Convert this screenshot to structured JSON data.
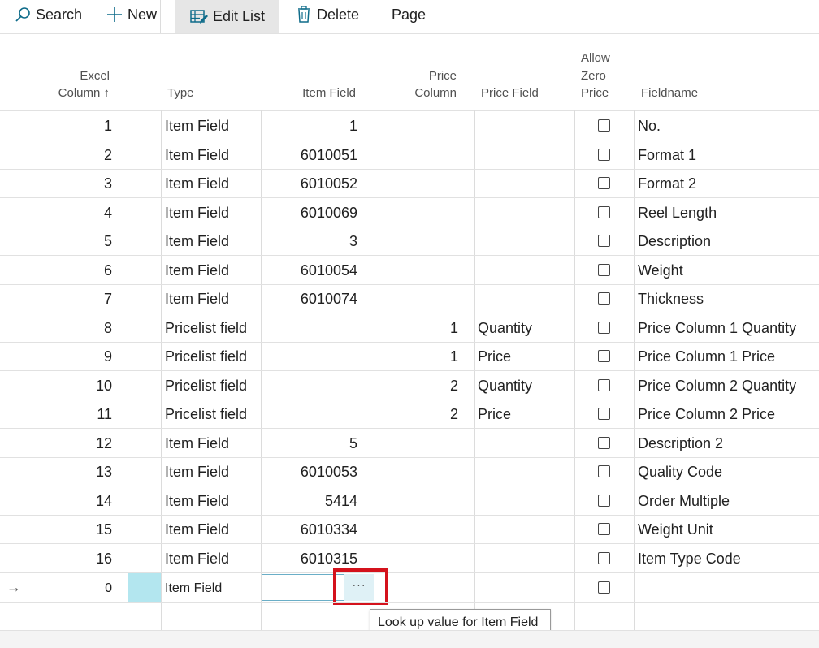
{
  "toolbar": {
    "search_label": "Search",
    "new_label": "New",
    "edit_list_label": "Edit List",
    "delete_label": "Delete",
    "page_label": "Page"
  },
  "columns": {
    "excel_column_line1": "Excel",
    "excel_column_line2": "Column ↑",
    "type": "Type",
    "item_field": "Item Field",
    "price_column_line1": "Price",
    "price_column_line2": "Column",
    "price_field": "Price Field",
    "allow_zero_line1": "Allow",
    "allow_zero_line2": "Zero",
    "allow_zero_line3": "Price",
    "fieldname": "Fieldname"
  },
  "rows": [
    {
      "excel_column": "1",
      "type": "Item Field",
      "item_field": "1",
      "price_column": "",
      "price_field": "",
      "allow_zero_price": false,
      "fieldname": "No."
    },
    {
      "excel_column": "2",
      "type": "Item Field",
      "item_field": "6010051",
      "price_column": "",
      "price_field": "",
      "allow_zero_price": false,
      "fieldname": "Format 1"
    },
    {
      "excel_column": "3",
      "type": "Item Field",
      "item_field": "6010052",
      "price_column": "",
      "price_field": "",
      "allow_zero_price": false,
      "fieldname": "Format 2"
    },
    {
      "excel_column": "4",
      "type": "Item Field",
      "item_field": "6010069",
      "price_column": "",
      "price_field": "",
      "allow_zero_price": false,
      "fieldname": "Reel Length"
    },
    {
      "excel_column": "5",
      "type": "Item Field",
      "item_field": "3",
      "price_column": "",
      "price_field": "",
      "allow_zero_price": false,
      "fieldname": "Description"
    },
    {
      "excel_column": "6",
      "type": "Item Field",
      "item_field": "6010054",
      "price_column": "",
      "price_field": "",
      "allow_zero_price": false,
      "fieldname": "Weight"
    },
    {
      "excel_column": "7",
      "type": "Item Field",
      "item_field": "6010074",
      "price_column": "",
      "price_field": "",
      "allow_zero_price": false,
      "fieldname": "Thickness"
    },
    {
      "excel_column": "8",
      "type": "Pricelist field",
      "item_field": "",
      "price_column": "1",
      "price_field": "Quantity",
      "allow_zero_price": false,
      "fieldname": "Price Column 1 Quantity"
    },
    {
      "excel_column": "9",
      "type": "Pricelist field",
      "item_field": "",
      "price_column": "1",
      "price_field": "Price",
      "allow_zero_price": false,
      "fieldname": "Price Column 1 Price"
    },
    {
      "excel_column": "10",
      "type": "Pricelist field",
      "item_field": "",
      "price_column": "2",
      "price_field": "Quantity",
      "allow_zero_price": false,
      "fieldname": "Price Column 2 Quantity"
    },
    {
      "excel_column": "11",
      "type": "Pricelist field",
      "item_field": "",
      "price_column": "2",
      "price_field": "Price",
      "allow_zero_price": false,
      "fieldname": "Price Column 2 Price"
    },
    {
      "excel_column": "12",
      "type": "Item Field",
      "item_field": "5",
      "price_column": "",
      "price_field": "",
      "allow_zero_price": false,
      "fieldname": "Description 2"
    },
    {
      "excel_column": "13",
      "type": "Item Field",
      "item_field": "6010053",
      "price_column": "",
      "price_field": "",
      "allow_zero_price": false,
      "fieldname": "Quality Code"
    },
    {
      "excel_column": "14",
      "type": "Item Field",
      "item_field": "5414",
      "price_column": "",
      "price_field": "",
      "allow_zero_price": false,
      "fieldname": "Order Multiple"
    },
    {
      "excel_column": "15",
      "type": "Item Field",
      "item_field": "6010334",
      "price_column": "",
      "price_field": "",
      "allow_zero_price": false,
      "fieldname": "Weight Unit"
    },
    {
      "excel_column": "16",
      "type": "Item Field",
      "item_field": "6010315",
      "price_column": "",
      "price_field": "",
      "allow_zero_price": false,
      "fieldname": "Item Type Code"
    }
  ],
  "new_row": {
    "indicator": "→",
    "excel_column": "0",
    "type": "Item Field",
    "item_field": "",
    "lookup_button": "···",
    "allow_zero_price": false
  },
  "tooltip": "Look up value for Item Field",
  "icons": {
    "search": "search-icon",
    "new": "plus-icon",
    "edit_list": "edit-list-icon",
    "delete": "trash-icon"
  },
  "colors": {
    "accent": "#0f6c8a",
    "selected_cell": "#b3e6ef",
    "highlight_box": "#d4121c"
  }
}
